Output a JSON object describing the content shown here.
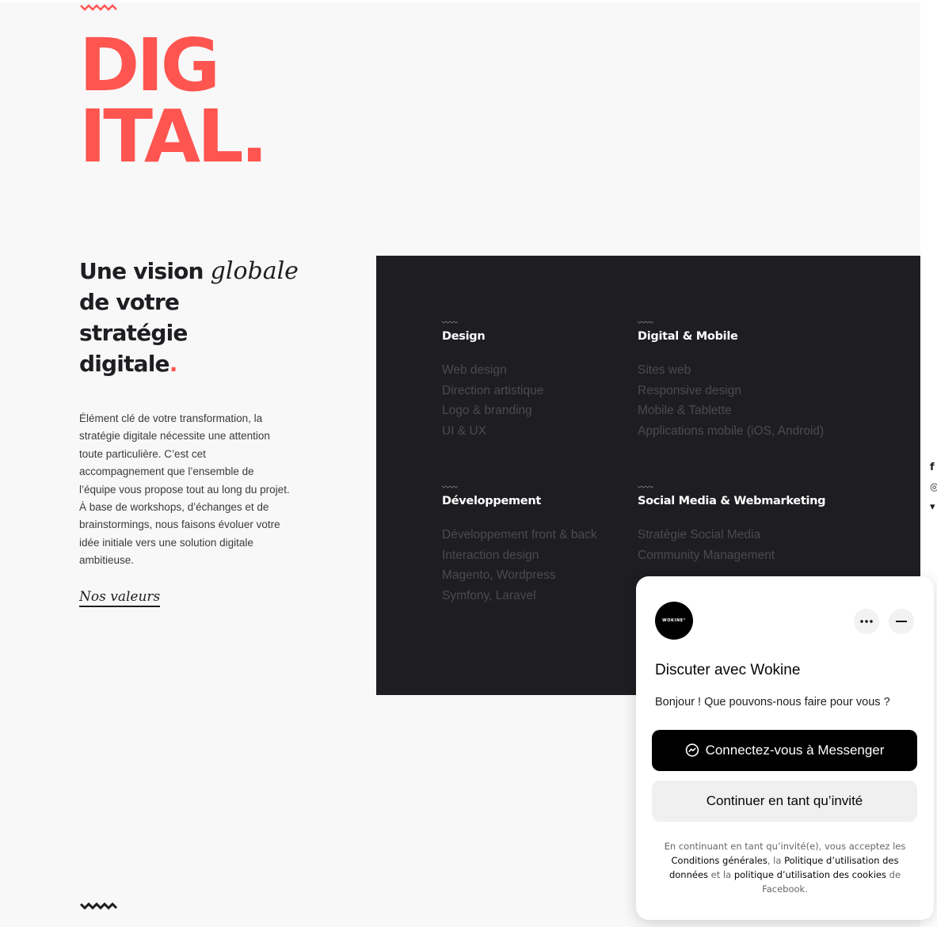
{
  "hero": {
    "line1": "DIG",
    "line2": "ITAL",
    "dot": "."
  },
  "vision": {
    "prefix": "Une vision ",
    "italic": "globale",
    "line2": "de votre",
    "line3": "stratégie",
    "line4": "digitale",
    "dot": "."
  },
  "intro": {
    "text": "Élément clé de votre transformation, la stratégie digitale nécessite une attention toute particulière. C’est cet accompagnement que l’ensemble de l’équipe vous propose tout au long du projet. À base de workshops, d’échanges et de brainstormings, nous faisons évoluer votre idée initiale vers une solution digitale ambitieuse."
  },
  "valeurs_link": "Nos valeurs",
  "services": [
    {
      "title": "Design",
      "items": [
        "Web design",
        "Direction artistique",
        "Logo & branding",
        "UI & UX"
      ]
    },
    {
      "title": "Digital & Mobile",
      "items": [
        "Sites web",
        "Responsive design",
        "Mobile & Tablette",
        "Applications mobile (iOS, Android)"
      ]
    },
    {
      "title": "Développement",
      "items": [
        "Développement front & back",
        "Interaction design",
        "Magento, Wordpress",
        "Symfony, Laravel"
      ]
    },
    {
      "title": "Social Media & Webmarketing",
      "items": [
        "Stratégie Social Media",
        "Community Management"
      ]
    }
  ],
  "social_icons": [
    "facebook-icon",
    "instagram-icon",
    "twitter-icon"
  ],
  "chat": {
    "logo_text": "WOKINE°",
    "title": "Discuter avec Wokine",
    "greeting": "Bonjour ! Que pouvons-nous faire pour vous ?",
    "messenger_button": "Connectez-vous à Messenger",
    "guest_button": "Continuer en tant qu’invité",
    "legal": {
      "part1": "En continuant en tant qu’invité(e), vous acceptez les ",
      "link1": "Conditions générales",
      "part2": ", la ",
      "link2": "Politique d’utilisation des données",
      "part3": " et la ",
      "link3": "politique d’utilisation des cookies",
      "part4": " de ",
      "part5": "Facebook",
      "part6": "."
    }
  },
  "colors": {
    "accent": "#ff5550",
    "dark": "#1e1e22",
    "page_bg": "#f8f8f8",
    "muted_service": "#4a4a50"
  }
}
